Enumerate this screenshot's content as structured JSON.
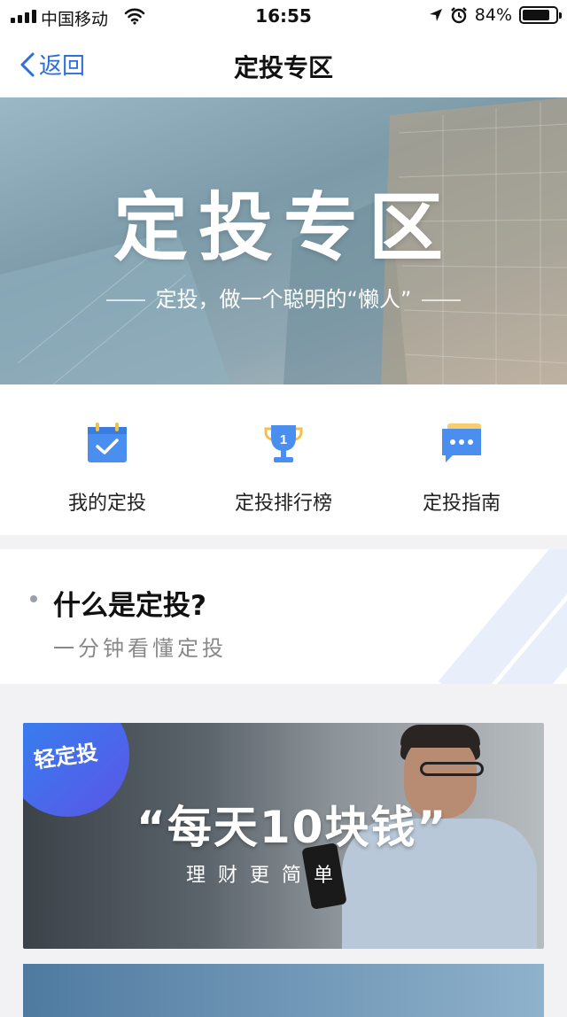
{
  "status_bar": {
    "carrier": "中国移动",
    "time": "16:55",
    "battery": "84%",
    "battery_level": 0.84
  },
  "nav": {
    "back_label": "返回",
    "title": "定投专区"
  },
  "banner": {
    "title": "定投专区",
    "subtitle": "定投，做一个聪明的“懒人”"
  },
  "menu": {
    "items": [
      {
        "label": "我的定投",
        "icon": "calendar-check-icon"
      },
      {
        "label": "定投排行榜",
        "icon": "trophy-icon"
      },
      {
        "label": "定投指南",
        "icon": "chat-bubble-icon"
      }
    ]
  },
  "intro": {
    "question": "什么是定投?",
    "subtitle": "一分钟看懂定投"
  },
  "promo": {
    "badge": "轻定投",
    "headline": "“每天10块钱”",
    "tagline": "理财更简单"
  },
  "colors": {
    "accent": "#2c6fd6",
    "icon_blue": "#4a8ff0",
    "icon_yellow": "#f5c04a"
  }
}
